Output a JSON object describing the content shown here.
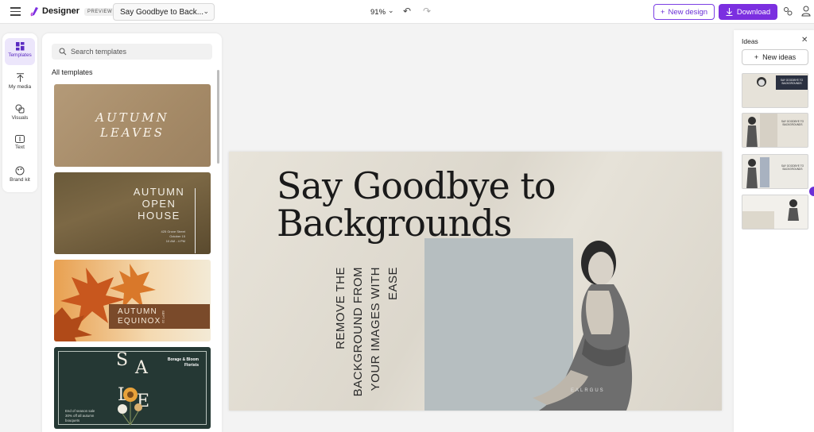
{
  "topbar": {
    "app_name": "Designer",
    "preview_label": "PREVIEW",
    "doc_title": "Say Goodbye to Back...",
    "zoom": "91%",
    "new_design_label": "New design",
    "download_label": "Download",
    "accent_color": "#7b2fe0"
  },
  "rail": {
    "items": [
      {
        "label": "Templates",
        "icon": "templates-icon",
        "active": true
      },
      {
        "label": "My media",
        "icon": "upload-icon"
      },
      {
        "label": "Visuals",
        "icon": "visuals-icon"
      },
      {
        "label": "Text",
        "icon": "text-icon"
      },
      {
        "label": "Brand kit",
        "icon": "brand-kit-icon"
      }
    ]
  },
  "templates": {
    "search_placeholder": "Search templates",
    "section_title": "All templates",
    "cards": [
      {
        "lines": [
          "AUTUMN",
          "LEAVES"
        ]
      },
      {
        "lines": [
          "AUTUMN",
          "OPEN",
          "HOUSE"
        ],
        "small": [
          "425 Grove Street",
          "October 15",
          "10 AM - 4 PM"
        ]
      },
      {
        "lines": [
          "AUTUMN",
          "EQUINOX"
        ],
        "vertical": "SEPT 22"
      },
      {
        "letters": [
          "S",
          "A",
          "L",
          "E"
        ],
        "brand": [
          "Borage & Bloom",
          "Florists"
        ],
        "footer": [
          "End of season sale",
          "30% off all autumn",
          "bouquets"
        ]
      }
    ]
  },
  "canvas": {
    "headline_line1": "Say Goodbye to",
    "headline_line2": "Backgrounds",
    "vertical_lines": [
      "REMOVE THE",
      "BACKGROUND FROM",
      "YOUR IMAGES WITH",
      "EASE"
    ],
    "watermark": "EALRGUS"
  },
  "ideas": {
    "title": "Ideas",
    "new_ideas_label": "New ideas",
    "thumbs": [
      {
        "text": "SAY GOODBYE TO BACKGROUNDS"
      },
      {
        "text": "SAY GOODBYE TO BACKGROUNDS"
      },
      {
        "text": "SAY GOODBYE TO BACKGROUNDS"
      },
      {
        "text": ""
      }
    ]
  }
}
